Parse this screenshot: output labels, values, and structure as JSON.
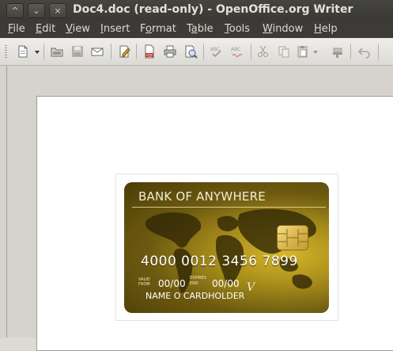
{
  "window": {
    "title": "Doc4.doc (read-only) - OpenOffice.org Writer",
    "controls": {
      "minimize": "^",
      "maximize": "⌄",
      "close": "×"
    }
  },
  "menubar": {
    "items": [
      {
        "pre": "",
        "acc": "F",
        "post": "ile"
      },
      {
        "pre": "",
        "acc": "E",
        "post": "dit"
      },
      {
        "pre": "",
        "acc": "V",
        "post": "iew"
      },
      {
        "pre": "",
        "acc": "I",
        "post": "nsert"
      },
      {
        "pre": "F",
        "acc": "o",
        "post": "rmat"
      },
      {
        "pre": "T",
        "acc": "a",
        "post": "ble"
      },
      {
        "pre": "",
        "acc": "T",
        "post": "ools"
      },
      {
        "pre": "",
        "acc": "W",
        "post": "indow"
      },
      {
        "pre": "",
        "acc": "H",
        "post": "elp"
      }
    ]
  },
  "toolbar": {
    "icons": [
      "new-document-icon",
      "dropdown-arrow-icon",
      "open-icon",
      "save-icon",
      "email-icon",
      "edit-file-icon",
      "export-pdf-icon",
      "print-icon",
      "print-preview-icon",
      "spellcheck-icon",
      "autospellcheck-icon",
      "cut-icon",
      "copy-icon",
      "paste-icon",
      "paste-dropdown-icon",
      "format-paintbrush-icon",
      "undo-icon"
    ],
    "pdf_label": "PDF"
  },
  "card": {
    "bank": "BANK OF ANYWHERE",
    "number": "4000  0012  3456  7899",
    "valid_from_label_1": "VALID",
    "valid_from_label_2": "FROM",
    "valid_from": "00/00",
    "expires_label_1": "EXPIRES",
    "expires_label_2": "END",
    "expires": "00/00",
    "network_mark": "V",
    "holder": "NAME O CARDHOLDER"
  },
  "colors": {
    "titlebar": "#3c3b37",
    "workspace": "#d6d3cc",
    "card_gold": "#a88d1a"
  }
}
